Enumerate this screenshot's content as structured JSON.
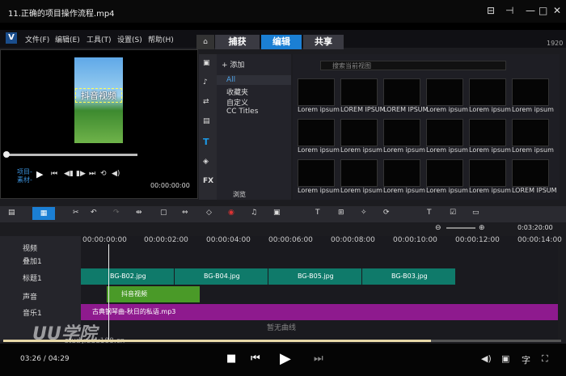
{
  "player": {
    "title": "11.正确的项目操作流程.mp4",
    "time_current": "03:26",
    "time_total": "04:29",
    "progress": 0.766
  },
  "app": {
    "menu": [
      "文件(F)",
      "编辑(E)",
      "工具(T)",
      "设置(S)",
      "帮助(H)"
    ],
    "tabs": [
      "捕获",
      "编辑",
      "共享"
    ],
    "active_tab": "编辑",
    "res": "1920",
    "preview": {
      "overlay_text": "抖音视频",
      "project_label": "项目-",
      "clip_label": "素材-",
      "timecode": "00:00:00:00"
    },
    "library": {
      "add_label": "添加",
      "search_placeholder": "搜索当前视图",
      "tree": [
        "All",
        "收藏夹",
        "自定义",
        "CC Titles"
      ],
      "browse_label": "浏览",
      "thumb_label": "Lorem ipsum",
      "thumb_label_alt": "LOREM IPSUM"
    },
    "timeline": {
      "zoom_time": "0:03:20:00",
      "ruler": [
        "00:00:00:00",
        "00:00:02:00",
        "00:00:04:00",
        "00:00:06:00",
        "00:00:08:00",
        "00:00:10:00",
        "00:00:12:00",
        "00:00:14:00"
      ],
      "tracks": [
        "视频",
        "叠加1",
        "标题1",
        "声音",
        "音乐1"
      ],
      "clips": [
        "BG-B02.jpg",
        "BG-B04.jpg",
        "BG-B05.jpg",
        "BG-B03.jpg"
      ],
      "title_clip": "抖音视频",
      "music_clip": "古典钢琴曲-秋日的私语.mp3",
      "no_curve": "暂无曲线"
    }
  },
  "watermark": {
    "brand": "UU学院",
    "url": "study.uuu188.cn"
  }
}
